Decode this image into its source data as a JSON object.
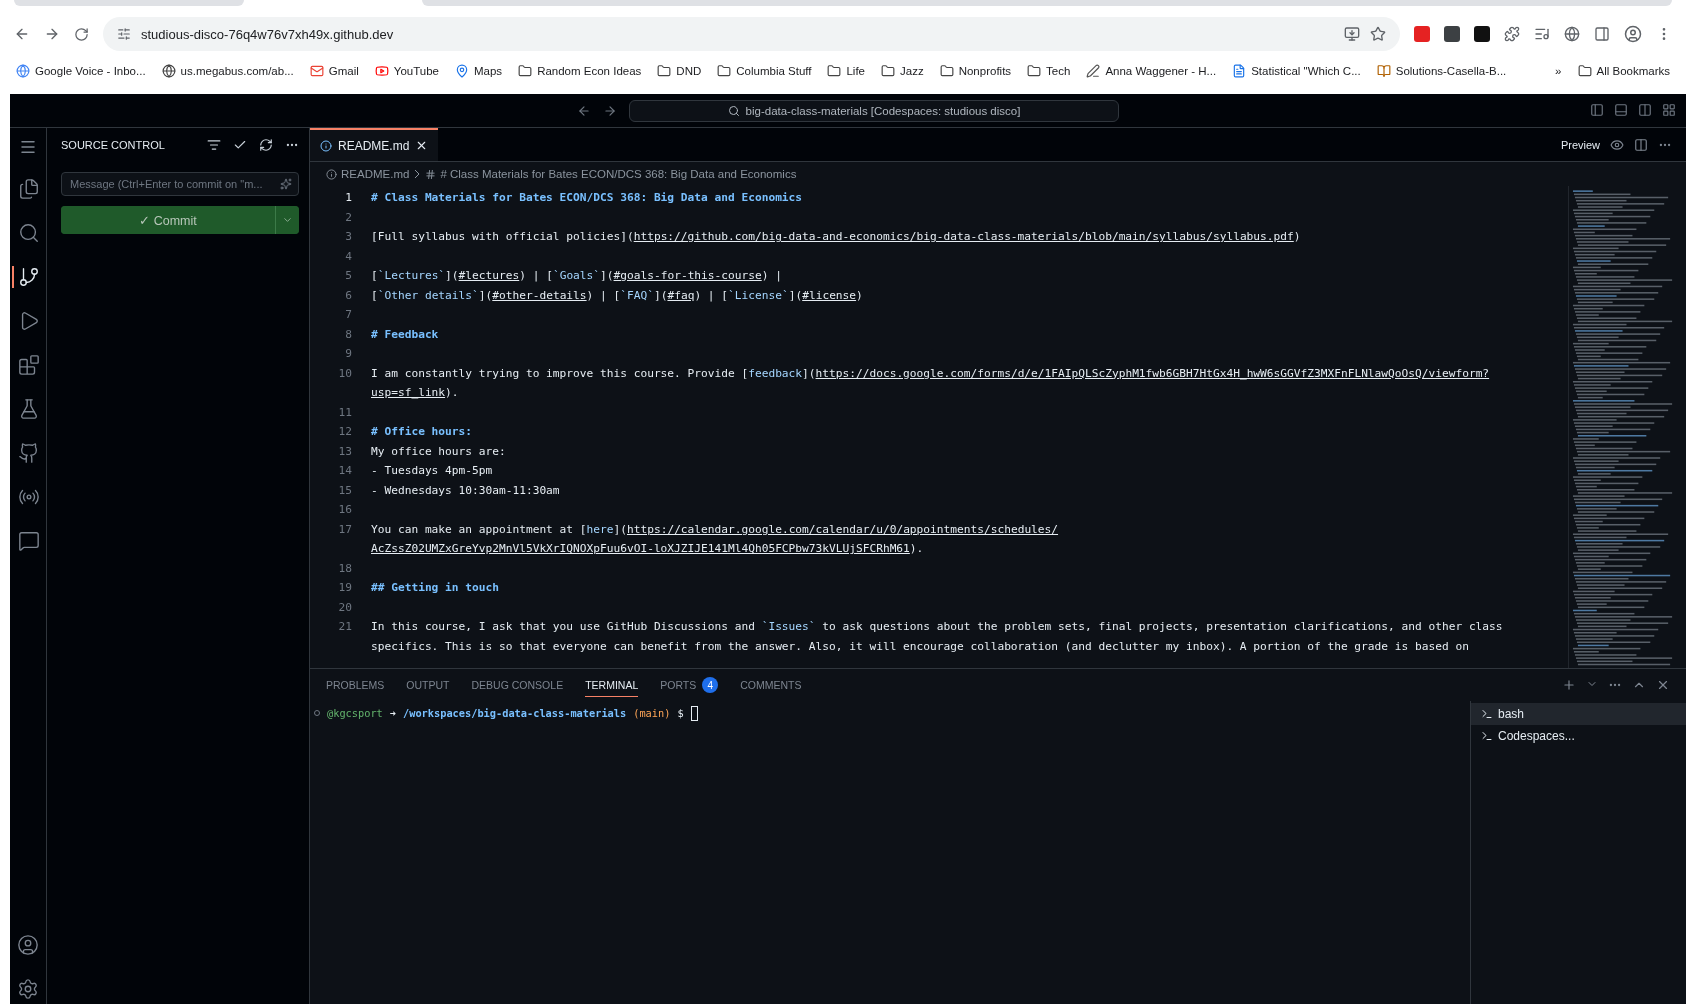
{
  "browser": {
    "url": "studious-disco-76q4w76v7xh49x.github.dev",
    "bookmarks": [
      {
        "label": "Google Voice - Inbo...",
        "kind": "google"
      },
      {
        "label": "us.megabus.com/ab...",
        "kind": "globe"
      },
      {
        "label": "Gmail",
        "kind": "mail"
      },
      {
        "label": "YouTube",
        "kind": "video"
      },
      {
        "label": "Maps",
        "kind": "pin"
      },
      {
        "label": "Random Econ Ideas",
        "kind": "folder"
      },
      {
        "label": "DND",
        "kind": "folder"
      },
      {
        "label": "Columbia Stuff",
        "kind": "folder"
      },
      {
        "label": "Life",
        "kind": "folder"
      },
      {
        "label": "Jazz",
        "kind": "folder"
      },
      {
        "label": "Nonprofits",
        "kind": "folder"
      },
      {
        "label": "Tech",
        "kind": "folder"
      },
      {
        "label": "Anna Waggener - H...",
        "kind": "signature"
      },
      {
        "label": "Statistical \"Which C...",
        "kind": "page"
      },
      {
        "label": "Solutions-Casella-B...",
        "kind": "book"
      }
    ],
    "overflow": "»",
    "all_bookmarks": "All Bookmarks"
  },
  "vscode": {
    "command_center": "big-data-class-materials [Codespaces: studious disco]",
    "activity_bar": [
      {
        "kind": "explorer",
        "selected": false
      },
      {
        "kind": "search",
        "selected": false
      },
      {
        "kind": "source_control",
        "selected": true
      },
      {
        "kind": "run",
        "selected": false
      },
      {
        "kind": "extensions",
        "selected": false
      },
      {
        "kind": "testing",
        "selected": false
      },
      {
        "kind": "github",
        "selected": false
      },
      {
        "kind": "remote",
        "selected": false
      },
      {
        "kind": "chat",
        "selected": false
      }
    ],
    "source_control": {
      "title": "SOURCE CONTROL",
      "placeholder": "Message (Ctrl+Enter to commit on \"m...",
      "commit": "✓ Commit"
    },
    "editor": {
      "tabs": [
        {
          "label": "README.md",
          "selected": true
        }
      ],
      "preview": "Preview",
      "breadcrumb": [
        "README.md",
        "# Class Materials for Bates ECON/DCS 368: Big Data and Economics"
      ],
      "lines": [
        {
          "number": "1",
          "current": true,
          "rows": [
            [
              {
                "kind": "heading",
                "text": "# Class Materials for Bates ECON/DCS 368: Big Data and Economics"
              }
            ]
          ]
        },
        {
          "number": "2",
          "current": false
        },
        {
          "number": "3",
          "current": false,
          "rows": [
            [
              {
                "kind": "text",
                "text": "[Full syllabus with official policies]("
              },
              {
                "kind": "url",
                "text": "https://github.com/big-data-and-economics/big-data-class-materials/blob/main/syllabus/syllabus.pdf"
              },
              {
                "kind": "text",
                "text": ")"
              }
            ]
          ]
        },
        {
          "number": "4",
          "current": false
        },
        {
          "number": "5",
          "current": false,
          "rows": [
            [
              {
                "kind": "text",
                "text": "["
              },
              {
                "kind": "code",
                "text": "`Lectures`"
              },
              {
                "kind": "text",
                "text": "]("
              },
              {
                "kind": "url",
                "text": "#lectures"
              },
              {
                "kind": "text",
                "text": ") | ["
              },
              {
                "kind": "code",
                "text": "`Goals`"
              },
              {
                "kind": "text",
                "text": "]("
              },
              {
                "kind": "url",
                "text": "#goals-for-this-course"
              },
              {
                "kind": "text",
                "text": ") |"
              }
            ]
          ]
        },
        {
          "number": "6",
          "current": false,
          "rows": [
            [
              {
                "kind": "text",
                "text": "["
              },
              {
                "kind": "code",
                "text": "`Other details`"
              },
              {
                "kind": "text",
                "text": "]("
              },
              {
                "kind": "url",
                "text": "#other-details"
              },
              {
                "kind": "text",
                "text": ") | ["
              },
              {
                "kind": "code",
                "text": "`FAQ`"
              },
              {
                "kind": "text",
                "text": "]("
              },
              {
                "kind": "url",
                "text": "#faq"
              },
              {
                "kind": "text",
                "text": ") | ["
              },
              {
                "kind": "code",
                "text": "`License`"
              },
              {
                "kind": "text",
                "text": "]("
              },
              {
                "kind": "url",
                "text": "#license"
              },
              {
                "kind": "text",
                "text": ")"
              }
            ]
          ]
        },
        {
          "number": "7",
          "current": false
        },
        {
          "number": "8",
          "current": false,
          "rows": [
            [
              {
                "kind": "heading",
                "text": "# Feedback"
              }
            ]
          ]
        },
        {
          "number": "9",
          "current": false
        },
        {
          "number": "10",
          "current": false,
          "rows": [
            [
              {
                "kind": "text",
                "text": "I am constantly trying to improve this course. Provide ["
              },
              {
                "kind": "label",
                "text": "feedback"
              },
              {
                "kind": "text",
                "text": "]("
              },
              {
                "kind": "url",
                "text": "https://docs.google.com/forms/d/e/1FAIpQLScZyphM1fwb6GBH7HtGx4H_hwW6sGGVfZ3MXFnFLNlawQoOsQ/viewform?"
              },
              {
                "kind": "url",
                "text": "usp=sf_link",
                "wrap_before": true
              },
              {
                "kind": "text",
                "text": ")."
              }
            ]
          ]
        },
        {
          "number": "11",
          "current": false
        },
        {
          "number": "12",
          "current": false,
          "rows": [
            [
              {
                "kind": "heading",
                "text": "# Office hours:"
              }
            ]
          ]
        },
        {
          "number": "13",
          "current": false,
          "rows": [
            [
              {
                "kind": "text",
                "text": "My office hours are:"
              }
            ]
          ]
        },
        {
          "number": "14",
          "current": false,
          "rows": [
            [
              {
                "kind": "text",
                "text": "- Tuesdays 4pm-5pm"
              }
            ]
          ]
        },
        {
          "number": "15",
          "current": false,
          "rows": [
            [
              {
                "kind": "text",
                "text": "- Wednesdays 10:30am-11:30am"
              }
            ]
          ]
        },
        {
          "number": "16",
          "current": false
        },
        {
          "number": "17",
          "current": false,
          "rows": [
            [
              {
                "kind": "text",
                "text": "You can make an appointment at ["
              },
              {
                "kind": "label",
                "text": "here"
              },
              {
                "kind": "text",
                "text": "]("
              },
              {
                "kind": "url",
                "text": "https://calendar.google.com/calendar/u/0/appointments/schedules/"
              },
              {
                "kind": "url",
                "text": "AcZssZ02UMZxGreYvp2MnVl5VkXrIQNOXpFuu6vOI-loXJZIJE141Ml4Qh05FCPbw73kVLUjSFCRhM61",
                "wrap_before": true
              },
              {
                "kind": "text",
                "text": ")."
              }
            ]
          ]
        },
        {
          "number": "18",
          "current": false
        },
        {
          "number": "19",
          "current": false,
          "rows": [
            [
              {
                "kind": "heading",
                "text": "## Getting in touch"
              }
            ]
          ]
        },
        {
          "number": "20",
          "current": false
        },
        {
          "number": "21",
          "current": false,
          "rows": [
            [
              {
                "kind": "text",
                "text": "In this course, I ask that you use GitHub Discussions and "
              },
              {
                "kind": "code",
                "text": "`Issues`"
              },
              {
                "kind": "text",
                "text": " to ask questions about the problem sets, final projects, presentation clarifications, and other class"
              },
              {
                "kind": "text",
                "wrap_before": true,
                "text": "specifics. This is so that everyone can benefit from the answer. Also, it will encourage collaboration (and declutter my inbox). A portion of the grade is based on"
              }
            ]
          ]
        }
      ]
    },
    "panel": {
      "tabs": [
        {
          "label": "PROBLEMS",
          "selected": false
        },
        {
          "label": "OUTPUT",
          "selected": false
        },
        {
          "label": "DEBUG CONSOLE",
          "selected": false
        },
        {
          "label": "TERMINAL",
          "selected": true
        },
        {
          "label": "PORTS",
          "selected": false,
          "badge": "4"
        },
        {
          "label": "COMMENTS",
          "selected": false
        }
      ],
      "prompt": [
        {
          "kind": "user",
          "text": "@kgcsport"
        },
        {
          "kind": "arrow",
          "text": "➜"
        },
        {
          "kind": "path",
          "text": "/workspaces/big-data-class-materials"
        },
        {
          "kind": "branch",
          "text": "(main)"
        },
        {
          "kind": "plain",
          "text": "$"
        }
      ],
      "terminals": [
        {
          "label": "bash",
          "selected": true
        },
        {
          "label": "Codespaces...",
          "selected": false
        }
      ]
    }
  }
}
